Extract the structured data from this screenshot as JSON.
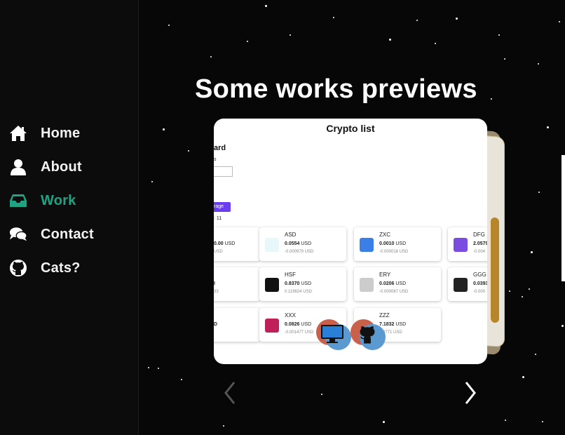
{
  "sidebar": {
    "items": [
      {
        "label": "Home",
        "icon": "home-icon"
      },
      {
        "label": "About",
        "icon": "user-icon"
      },
      {
        "label": "Work",
        "icon": "inbox-icon",
        "active": true
      },
      {
        "label": "Contact",
        "icon": "chat-bubbles-icon"
      },
      {
        "label": "Cats?",
        "icon": "github-icon"
      }
    ],
    "active_color": "#1fa383"
  },
  "main": {
    "title": "Some works previews",
    "preview": {
      "title": "Crypto list",
      "header_fragment": "ard",
      "small_fragment": "s",
      "button_fragment": "rage",
      "count_fragment": ": 11",
      "tiles": [
        {
          "name": "",
          "price": "0.00",
          "unit": "USD",
          "change": "USD",
          "icon": "none"
        },
        {
          "name": "ASD",
          "price": "0.0554",
          "unit": "USD",
          "change": "-0.000979 USD",
          "icon": "asd-coin-icon"
        },
        {
          "name": "ZXC",
          "price": "0.0010",
          "unit": "USD",
          "change": "-0.000018 USD",
          "icon": "zxc-coin-icon"
        },
        {
          "name": "DFG",
          "price": "2.0579",
          "unit": "",
          "change": "-0.004",
          "icon": "dfg-coin-icon"
        },
        {
          "name": "",
          "price": "I",
          "unit": "",
          "change": "33",
          "icon": "none"
        },
        {
          "name": "HSF",
          "price": "0.8370",
          "unit": "USD",
          "change": "0.119624 USD",
          "icon": "hsf-coin-icon"
        },
        {
          "name": "ERY",
          "price": "0.0206",
          "unit": "USD",
          "change": "-0.000067 USD",
          "icon": "ery-coin-icon"
        },
        {
          "name": "GGG",
          "price": "0.0393",
          "unit": "",
          "change": "-0.000",
          "icon": "ggg-coin-icon"
        },
        {
          "name": "",
          "price": "D",
          "unit": "",
          "change": "",
          "icon": "none"
        },
        {
          "name": "XXX",
          "price": "0.0826",
          "unit": "USD",
          "change": "-0.001477 USD",
          "icon": "xxx-coin-icon"
        },
        {
          "name": "ZZZ",
          "price": "7.1832",
          "unit": "USD",
          "change": "0.0771 USD",
          "icon": "zzz-coin-icon"
        }
      ],
      "actions": [
        {
          "icon": "monitor-icon",
          "label": "live demo"
        },
        {
          "icon": "github-icon",
          "label": "source"
        }
      ]
    },
    "prev_icon": "chevron-left-icon",
    "next_icon": "chevron-right-icon"
  }
}
